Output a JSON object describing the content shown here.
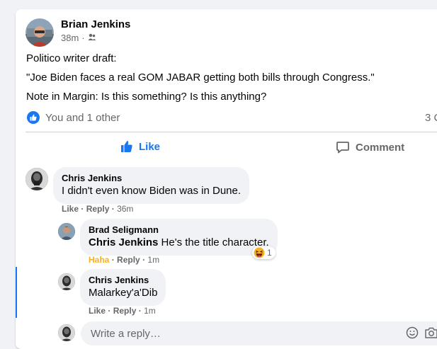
{
  "post": {
    "author": "Brian Jenkins",
    "time": "38m",
    "separator": "·",
    "audience_icon": "friends-icon",
    "lines": [
      "Politico writer draft:",
      "\"Joe Biden faces a real GOM JABAR getting both bills through Congress.\"",
      "Note in Margin: Is this something? Is this anything?"
    ],
    "reactions_text": "You and 1 other",
    "comments_count": "3 C"
  },
  "actions": {
    "like": "Like",
    "comment": "Comment"
  },
  "comments": [
    {
      "name": "Chris Jenkins",
      "text": "I didn't even know Biden was in Dune.",
      "like": "Like",
      "reply": "Reply",
      "time": "36m",
      "replies": [
        {
          "name": "Brad Seligmann",
          "mention": "Chris Jenkins",
          "text": "He's the title character.",
          "reaction_label": "Haha",
          "reply": "Reply",
          "time": "1m",
          "reaction_count": "1"
        },
        {
          "name": "Chris Jenkins",
          "text": "Malarkey'a'Dib",
          "like": "Like",
          "reply": "Reply",
          "time": "1m"
        }
      ]
    }
  ],
  "reply_box": {
    "placeholder": "Write a reply…"
  },
  "colors": {
    "accent": "#1877f2",
    "haha": "#f7b125",
    "muted": "#65676b",
    "bubble": "#f0f2f5"
  }
}
